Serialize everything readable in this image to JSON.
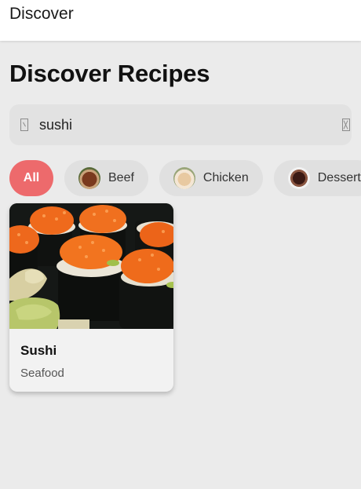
{
  "appbar": {
    "title": "Discover"
  },
  "page": {
    "heading": "Discover Recipes"
  },
  "search": {
    "value": "sushi",
    "search_icon": "search-icon",
    "clear_icon": "clear-icon"
  },
  "categories": [
    {
      "label": "All",
      "selected": true
    },
    {
      "label": "Beef",
      "thumb": "beef-thumbnail"
    },
    {
      "label": "Chicken",
      "thumb": "chicken-thumbnail"
    },
    {
      "label": "Dessert",
      "thumb": "dessert-thumbnail"
    }
  ],
  "results": [
    {
      "title": "Sushi",
      "category": "Seafood",
      "image": "sushi-photo"
    }
  ],
  "colors": {
    "accent": "#ed6a6c",
    "background": "#ebebeb",
    "search_field": "#e2e2e2",
    "chip": "#e0e0e0"
  }
}
